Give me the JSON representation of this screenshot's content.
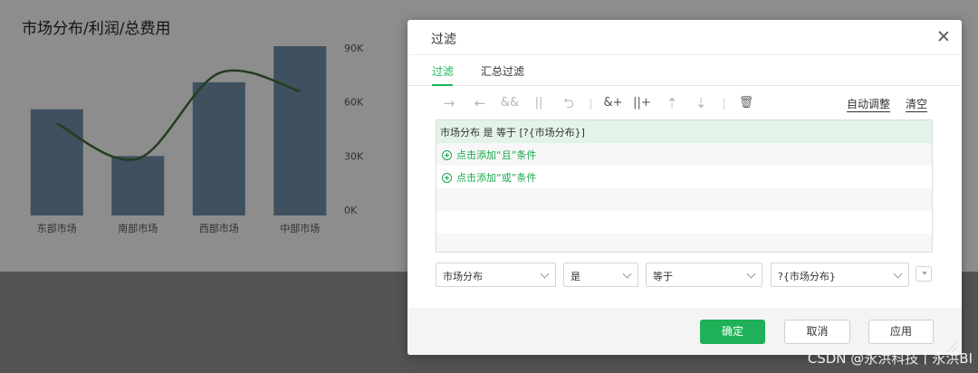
{
  "chart": {
    "title": "市场分布/利润/总费用"
  },
  "chart_data": {
    "type": "bar",
    "categories": [
      "东部市场",
      "南部市场",
      "西部市场",
      "中部市场"
    ],
    "series": [
      {
        "values": [
          59000,
          33000,
          74000,
          94000
        ],
        "color": "#6d8aa4"
      },
      {
        "values": [
          51000,
          31500,
          79000,
          69000
        ],
        "color": "#3e6a37"
      }
    ],
    "ylim": [
      0,
      90000
    ],
    "yticks": [
      "0K",
      "30K",
      "60K",
      "90K"
    ],
    "ytick_values": [
      0,
      30000,
      60000,
      90000
    ],
    "y_axis_side": "right"
  },
  "dialog": {
    "title": "过滤",
    "tabs": [
      {
        "label": "过滤"
      },
      {
        "label": "汇总过滤"
      }
    ],
    "toolbar": {
      "icons": [
        "→",
        "←",
        "&&",
        "||",
        "⮌",
        "&+",
        "||+",
        "⇡",
        "⇣",
        "🗑"
      ],
      "auto_adjust": "自动调整",
      "clear": "清空"
    },
    "condition": "市场分布 是 等于 [?{市场分布}]",
    "add_and": "点击添加“且”条件",
    "add_or": "点击添加“或”条件",
    "editor": {
      "field": "市场分布",
      "op1": "是",
      "op2": "等于",
      "value": "?{市场分布}"
    },
    "buttons": {
      "ok": "确定",
      "cancel": "取消",
      "apply": "应用"
    }
  },
  "accent_color": "#1fb157",
  "watermark": "CSDN @永洪科技丨永洪BI"
}
